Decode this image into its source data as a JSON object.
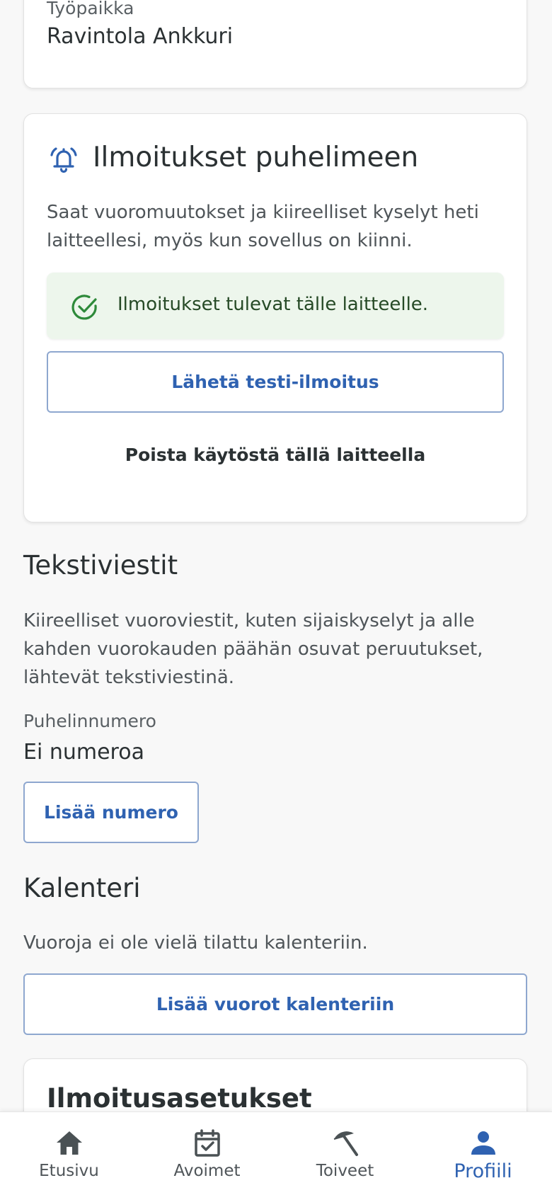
{
  "workplace": {
    "label": "Työpaikka",
    "value": "Ravintola Ankkuri"
  },
  "push": {
    "icon": "bell-ringing-icon",
    "title": "Ilmoitukset puhelimeen",
    "description_line1": "Saat vuoromuutokset ja kiireelliset kyselyt heti",
    "description_line2": "laitteellesi, myös kun sovellus on kiinni.",
    "status_icon": "check-circle-icon",
    "status_text": "Ilmoitukset tulevat tälle laitteelle.",
    "test_button": "Lähetä testi-ilmoitus",
    "disable_button": "Poista käytöstä tällä laitteella"
  },
  "sms": {
    "title": "Tekstiviestit",
    "description_line1": "Kiireelliset vuoroviestit, kuten sijaiskyselyt ja alle",
    "description_line2": "kahden vuorokauden päähän osuvat peruutukset,",
    "description_line3": "lähtevät tekstiviestinä.",
    "phone_label": "Puhelinnumero",
    "phone_value": "Ei numeroa",
    "add_number_button": "Lisää numero"
  },
  "calendar": {
    "title": "Kalenteri",
    "description": "Vuoroja ei ole vielä tilattu kalenteriin.",
    "add_button": "Lisää vuorot kalenteriin"
  },
  "settings": {
    "title": "Ilmoitusasetukset"
  },
  "nav": {
    "items": [
      {
        "label": "Etusivu",
        "icon": "home-icon"
      },
      {
        "label": "Avoimet",
        "icon": "calendar-check-icon"
      },
      {
        "label": "Toiveet",
        "icon": "beach-umbrella-icon"
      },
      {
        "label": "Profiili",
        "icon": "person-icon",
        "active": true
      }
    ]
  },
  "colors": {
    "accent": "#2f62b1",
    "success_bg": "#edf6ec",
    "success_icon": "#2e8a3a",
    "background": "#f8f8f8"
  }
}
